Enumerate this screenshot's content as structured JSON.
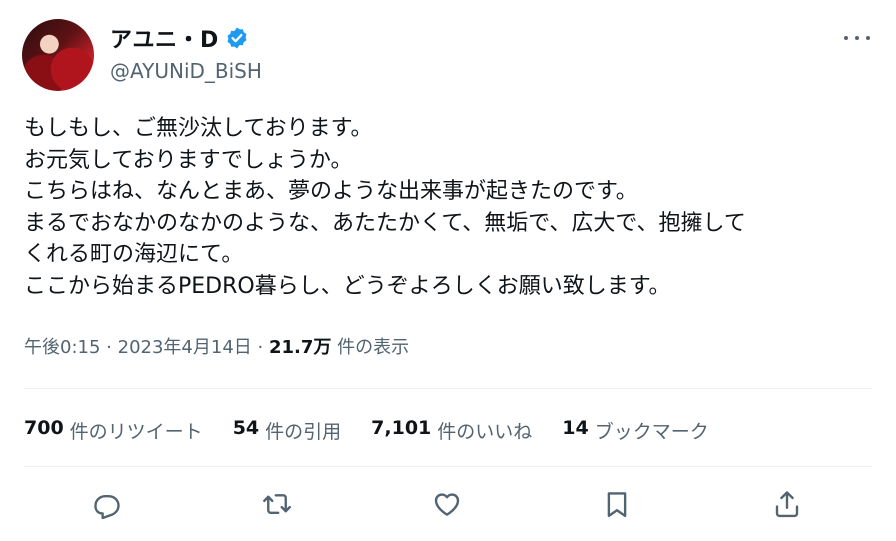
{
  "author": {
    "display_name": "アユニ・D",
    "handle": "@AYUNiD_BiSH"
  },
  "tweet": {
    "text": "もしもし、ご無沙汰しております。\nお元気しておりますでしょうか。\nこちらはね、なんとまあ、夢のような出来事が起きたのです。\nまるでおなかのなかのような、あたたかくて、無垢で、広大で、抱擁して\nくれる町の海辺にて。\nここから始まるPEDRO暮らし、どうぞよろしくお願い致します。"
  },
  "meta": {
    "time": "午後0:15",
    "separator": "·",
    "date": "2023年4月14日",
    "views": "21.7万",
    "views_label": "件の表示"
  },
  "stats": {
    "retweets": {
      "count": "700",
      "label": "件のリツイート"
    },
    "quotes": {
      "count": "54",
      "label": "件の引用"
    },
    "likes": {
      "count": "7,101",
      "label": "件のいいね"
    },
    "bookmarks": {
      "count": "14",
      "label": "ブックマーク"
    }
  },
  "icons": {
    "verified": "verified-badge-icon",
    "more": "more-options-icon",
    "reply": "reply-icon",
    "retweet": "retweet-icon",
    "like": "heart-icon",
    "bookmark": "bookmark-icon",
    "share": "share-icon"
  },
  "colors": {
    "verified": "#1d9bf0",
    "text": "#0f1419",
    "secondary": "#536471",
    "divider": "#eff3f4"
  }
}
